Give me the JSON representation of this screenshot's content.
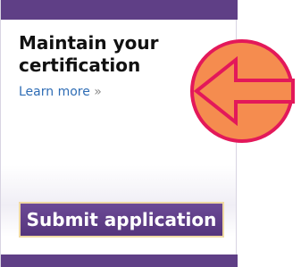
{
  "promo": {
    "heading_line1": "Maintain your",
    "heading_line2": "certification",
    "learn_more": "Learn more",
    "learn_more_chevron": "»",
    "submit_label": "Submit application"
  },
  "icons": {
    "annotation": "left-arrow-icon"
  },
  "colors": {
    "brand_purple": "#5f3f86",
    "link_blue": "#2f6db5",
    "button_border": "#efd9a3",
    "badge_fill": "#f58c4f",
    "badge_stroke": "#e3185a"
  }
}
